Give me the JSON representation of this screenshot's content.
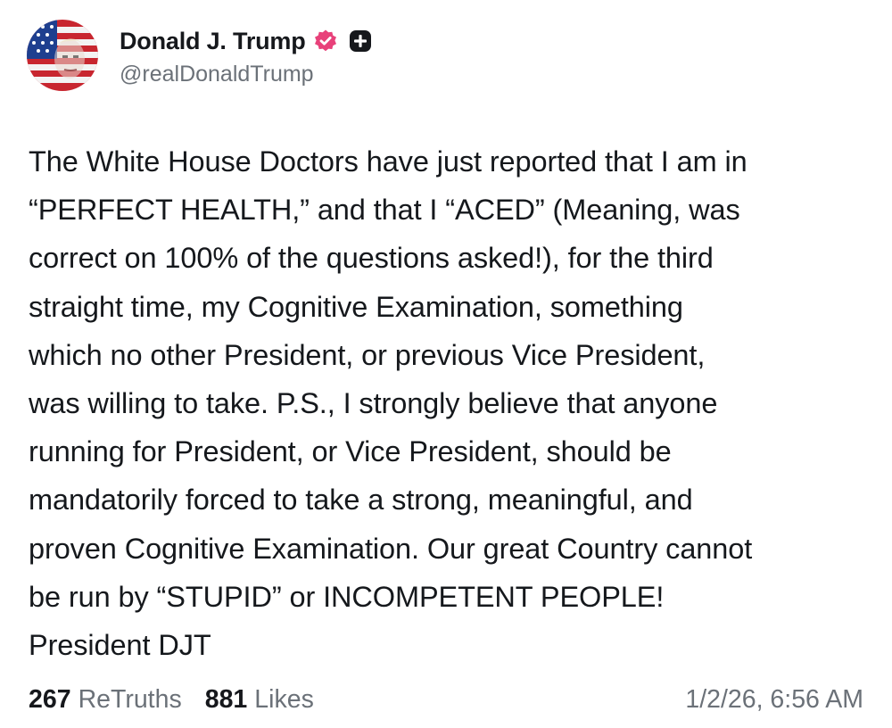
{
  "author": {
    "display_name": "Donald J. Trump",
    "handle": "@realDonaldTrump",
    "verified_icon": "verified-badge-icon",
    "plus_icon": "plus-square-icon",
    "verified_color": "#e8417a"
  },
  "post": {
    "text": "The White House Doctors have just reported that I am in\n“PERFECT HEALTH,” and that I “ACED” (Meaning, was\ncorrect on 100% of the questions asked!), for the third\nstraight time, my Cognitive Examination, something\nwhich no other President, or previous Vice President,\nwas willing to take. P.S., I strongly believe that anyone\nrunning for President, or Vice President, should be\nmandatorily forced to take a strong, meaningful, and\nproven Cognitive Examination. Our great Country cannot\nbe run by “STUPID” or INCOMPETENT PEOPLE!\nPresident DJT"
  },
  "stats": {
    "retruths_count": "267",
    "retruths_label": "ReTruths",
    "likes_count": "881",
    "likes_label": "Likes",
    "timestamp": "1/2/26, 6:56 AM"
  }
}
